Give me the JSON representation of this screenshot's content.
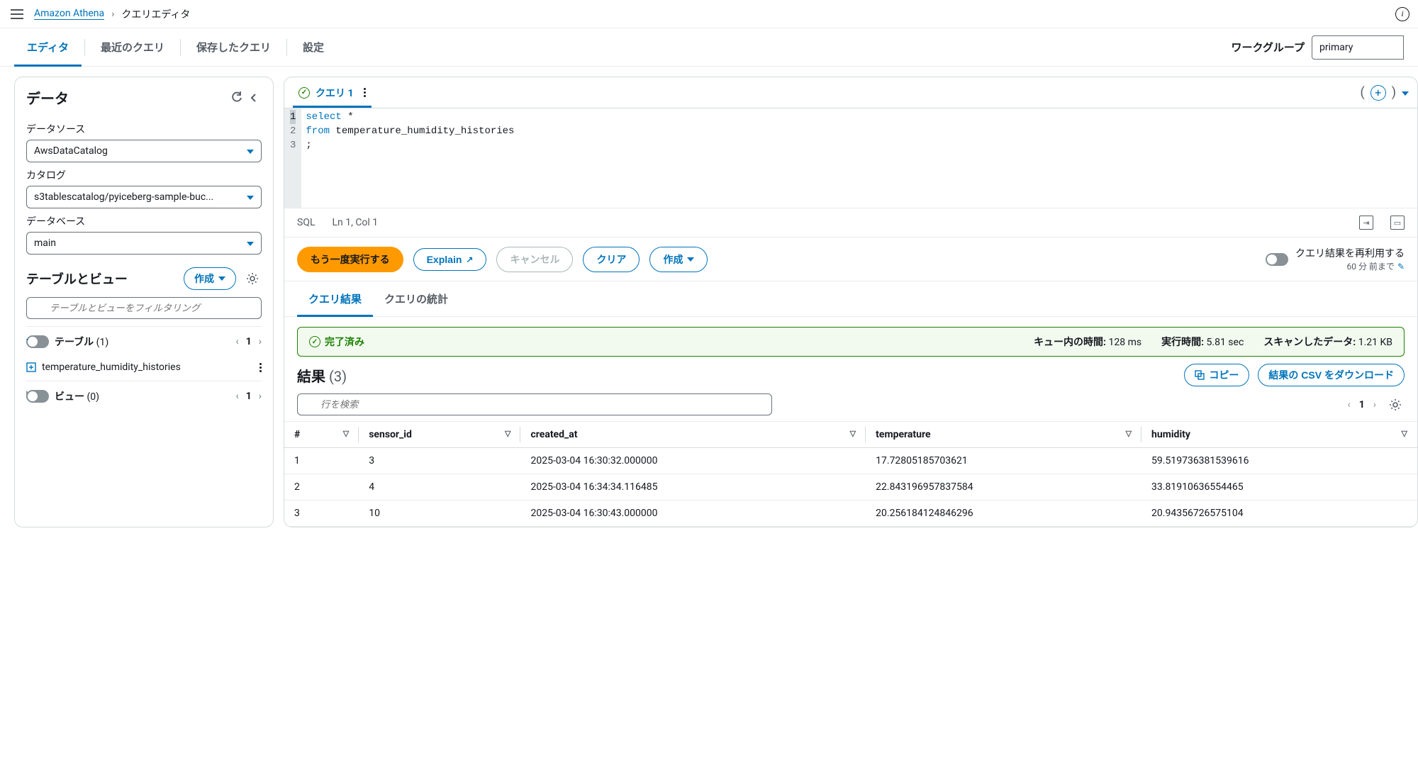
{
  "breadcrumb": {
    "service": "Amazon Athena",
    "current": "クエリエディタ"
  },
  "tabs": {
    "editor": "エディタ",
    "recent": "最近のクエリ",
    "saved": "保存したクエリ",
    "settings": "設定"
  },
  "workgroup": {
    "label": "ワークグループ",
    "value": "primary"
  },
  "sidebar": {
    "title": "データ",
    "datasource_label": "データソース",
    "datasource_value": "AwsDataCatalog",
    "catalog_label": "カタログ",
    "catalog_value": "s3tablescatalog/pyiceberg-sample-buc...",
    "database_label": "データベース",
    "database_value": "main",
    "tables_views_title": "テーブルとビュー",
    "create_btn": "作成",
    "filter_placeholder": "テーブルとビューをフィルタリング",
    "tables_label": "テーブル",
    "tables_count": "(1)",
    "tables_page": "1",
    "table_item": "temperature_humidity_histories",
    "views_label": "ビュー",
    "views_count": "(0)",
    "views_page": "1"
  },
  "query_tab": {
    "label": "クエリ 1"
  },
  "editor": {
    "line1_kw": "select",
    "line1_rest": " *",
    "line2_kw": "from",
    "line2_rest": " temperature_humidity_histories",
    "line3": ";"
  },
  "editor_status": {
    "lang": "SQL",
    "pos": "Ln 1, Col 1"
  },
  "actions": {
    "run": "もう一度実行する",
    "explain": "Explain",
    "cancel": "キャンセル",
    "clear": "クリア",
    "create": "作成",
    "reuse": "クエリ結果を再利用する",
    "reuse_sub": "60 分 前まで"
  },
  "result_tabs": {
    "results": "クエリ結果",
    "stats": "クエリの統計"
  },
  "status": {
    "completed": "完了済み",
    "queue_label": "キュー内の時間:",
    "queue_val": "128 ms",
    "exec_label": "実行時間:",
    "exec_val": "5.81 sec",
    "scan_label": "スキャンしたデータ:",
    "scan_val": "1.21 KB"
  },
  "results": {
    "title": "結果",
    "count": "(3)",
    "copy": "コピー",
    "download": "結果の CSV をダウンロード",
    "search_placeholder": "行を検索",
    "page": "1",
    "columns": {
      "idx": "#",
      "sensor": "sensor_id",
      "created": "created_at",
      "temp": "temperature",
      "hum": "humidity"
    },
    "rows": [
      {
        "idx": "1",
        "sensor": "3",
        "created": "2025-03-04 16:30:32.000000",
        "temp": "17.72805185703621",
        "hum": "59.519736381539616"
      },
      {
        "idx": "2",
        "sensor": "4",
        "created": "2025-03-04 16:34:34.116485",
        "temp": "22.843196957837584",
        "hum": "33.81910636554465"
      },
      {
        "idx": "3",
        "sensor": "10",
        "created": "2025-03-04 16:30:43.000000",
        "temp": "20.256184124846296",
        "hum": "20.94356726575104"
      }
    ]
  }
}
